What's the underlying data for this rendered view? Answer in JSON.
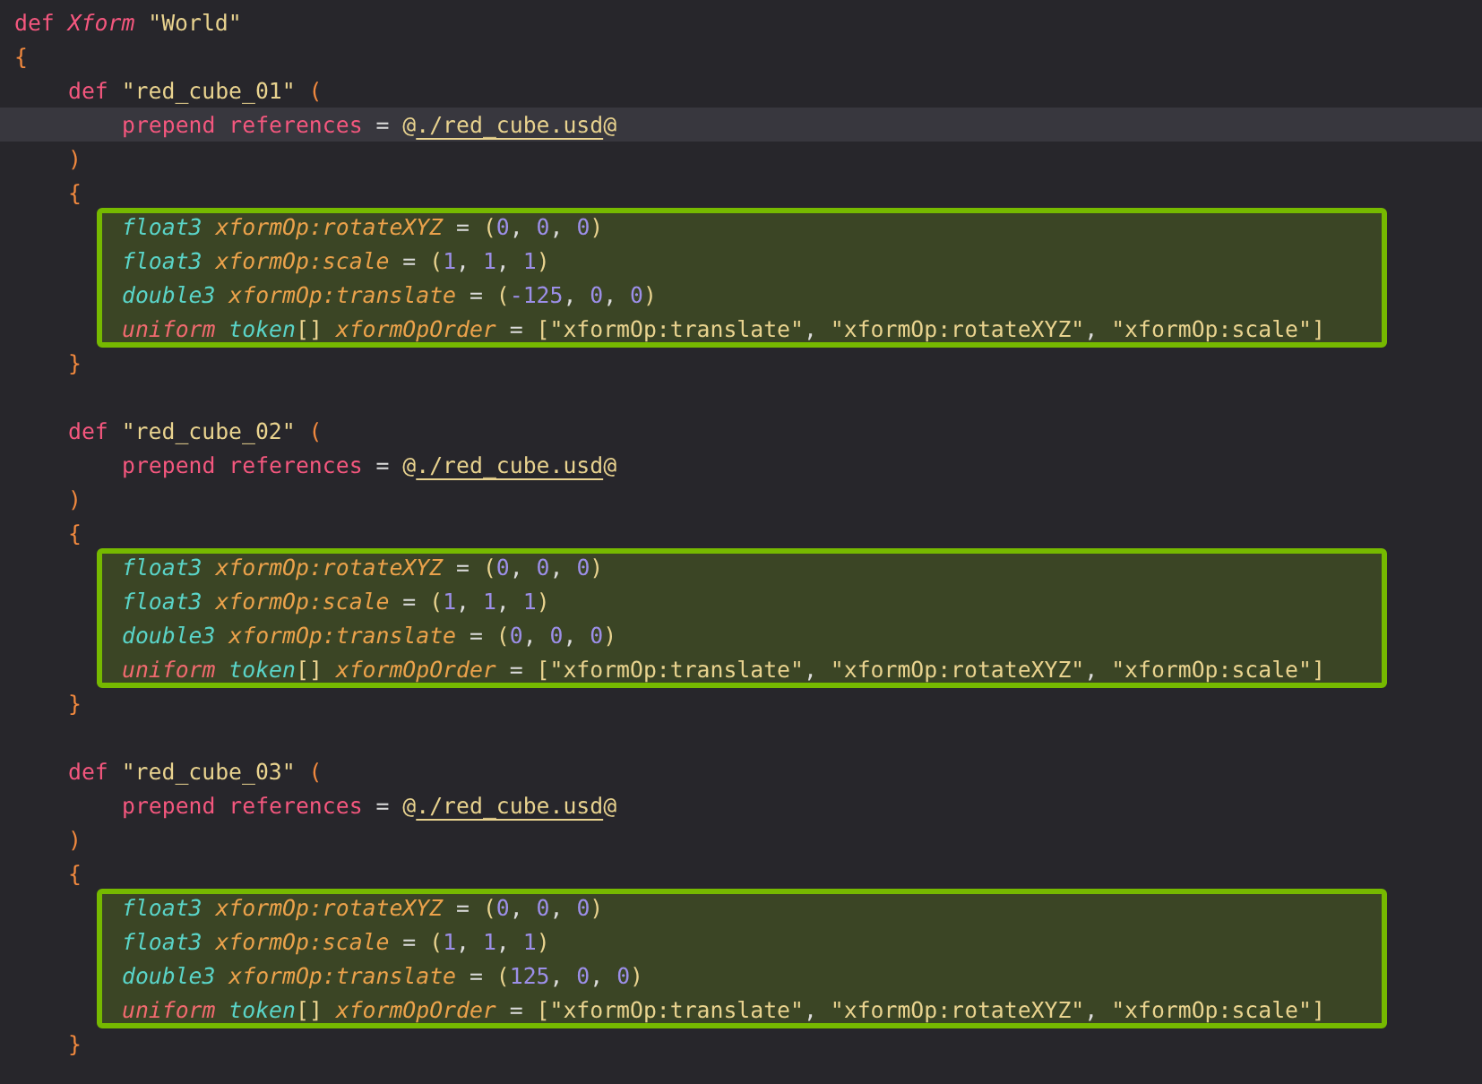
{
  "editor": {
    "lines": [
      {
        "kind": "line",
        "current": false,
        "tokens": [
          {
            "kind": "keyword",
            "text": "def"
          },
          {
            "kind": "typename",
            "text": " Xform"
          },
          {
            "kind": "string",
            "text": " \"World\""
          }
        ]
      },
      {
        "kind": "line",
        "current": false,
        "tokens": [
          {
            "kind": "brace",
            "text": "{"
          }
        ]
      },
      {
        "kind": "block",
        "children": [
          {
            "kind": "line",
            "current": false,
            "tokens": [
              {
                "kind": "keyword",
                "text": "def"
              },
              {
                "kind": "string",
                "text": " \"red_cube_01\""
              },
              {
                "kind": "brace",
                "text": " ("
              }
            ]
          },
          {
            "kind": "block",
            "children": [
              {
                "kind": "line",
                "current": true,
                "tokens": [
                  {
                    "kind": "keyword",
                    "text": "prepend"
                  },
                  {
                    "kind": "keyword",
                    "text": " references"
                  },
                  {
                    "kind": "operator",
                    "text": " = "
                  },
                  {
                    "kind": "string",
                    "text": "@"
                  },
                  {
                    "kind": "path",
                    "text": "./red_cube.usd"
                  },
                  {
                    "kind": "string",
                    "text": "@"
                  }
                ]
              }
            ]
          },
          {
            "kind": "line",
            "current": false,
            "tokens": [
              {
                "kind": "brace",
                "text": ")"
              }
            ]
          },
          {
            "kind": "line",
            "current": false,
            "tokens": [
              {
                "kind": "brace",
                "text": "{"
              }
            ]
          },
          {
            "kind": "highlight",
            "lines": [
              {
                "kind": "line",
                "current": false,
                "tokens": [
                  {
                    "kind": "type",
                    "text": "float3"
                  },
                  {
                    "kind": "attr",
                    "text": " xformOp:rotateXYZ"
                  },
                  {
                    "kind": "operator",
                    "text": " = "
                  },
                  {
                    "kind": "string",
                    "text": "("
                  },
                  {
                    "kind": "number",
                    "text": "0"
                  },
                  {
                    "kind": "operator",
                    "text": ", "
                  },
                  {
                    "kind": "number",
                    "text": "0"
                  },
                  {
                    "kind": "operator",
                    "text": ", "
                  },
                  {
                    "kind": "number",
                    "text": "0"
                  },
                  {
                    "kind": "string",
                    "text": ")"
                  }
                ]
              },
              {
                "kind": "line",
                "current": false,
                "tokens": [
                  {
                    "kind": "type",
                    "text": "float3"
                  },
                  {
                    "kind": "attr",
                    "text": " xformOp:scale"
                  },
                  {
                    "kind": "operator",
                    "text": " = "
                  },
                  {
                    "kind": "string",
                    "text": "("
                  },
                  {
                    "kind": "number",
                    "text": "1"
                  },
                  {
                    "kind": "operator",
                    "text": ", "
                  },
                  {
                    "kind": "number",
                    "text": "1"
                  },
                  {
                    "kind": "operator",
                    "text": ", "
                  },
                  {
                    "kind": "number",
                    "text": "1"
                  },
                  {
                    "kind": "string",
                    "text": ")"
                  }
                ]
              },
              {
                "kind": "line",
                "current": false,
                "tokens": [
                  {
                    "kind": "type",
                    "text": "double3"
                  },
                  {
                    "kind": "attr",
                    "text": " xformOp:translate"
                  },
                  {
                    "kind": "operator",
                    "text": " = "
                  },
                  {
                    "kind": "string",
                    "text": "("
                  },
                  {
                    "kind": "number",
                    "text": "-125"
                  },
                  {
                    "kind": "operator",
                    "text": ", "
                  },
                  {
                    "kind": "number",
                    "text": "0"
                  },
                  {
                    "kind": "operator",
                    "text": ", "
                  },
                  {
                    "kind": "number",
                    "text": "0"
                  },
                  {
                    "kind": "string",
                    "text": ")"
                  }
                ]
              },
              {
                "kind": "line",
                "current": false,
                "tokens": [
                  {
                    "kind": "uniform",
                    "text": "uniform"
                  },
                  {
                    "kind": "type",
                    "text": " token"
                  },
                  {
                    "kind": "string",
                    "text": "[]"
                  },
                  {
                    "kind": "attr",
                    "text": " xformOpOrder"
                  },
                  {
                    "kind": "operator",
                    "text": " = "
                  },
                  {
                    "kind": "string",
                    "text": "[\"xformOp:translate\""
                  },
                  {
                    "kind": "operator",
                    "text": ", "
                  },
                  {
                    "kind": "string",
                    "text": "\"xformOp:rotateXYZ\""
                  },
                  {
                    "kind": "operator",
                    "text": ", "
                  },
                  {
                    "kind": "string",
                    "text": "\"xformOp:scale\"]"
                  }
                ]
              }
            ]
          },
          {
            "kind": "line",
            "current": false,
            "tokens": [
              {
                "kind": "brace",
                "text": "}"
              }
            ]
          },
          {
            "kind": "blank"
          },
          {
            "kind": "line",
            "current": false,
            "tokens": [
              {
                "kind": "keyword",
                "text": "def"
              },
              {
                "kind": "string",
                "text": " \"red_cube_02\""
              },
              {
                "kind": "brace",
                "text": " ("
              }
            ]
          },
          {
            "kind": "block",
            "children": [
              {
                "kind": "line",
                "current": false,
                "tokens": [
                  {
                    "kind": "keyword",
                    "text": "prepend"
                  },
                  {
                    "kind": "keyword",
                    "text": " references"
                  },
                  {
                    "kind": "operator",
                    "text": " = "
                  },
                  {
                    "kind": "string",
                    "text": "@"
                  },
                  {
                    "kind": "path",
                    "text": "./red_cube.usd"
                  },
                  {
                    "kind": "string",
                    "text": "@"
                  }
                ]
              }
            ]
          },
          {
            "kind": "line",
            "current": false,
            "tokens": [
              {
                "kind": "brace",
                "text": ")"
              }
            ]
          },
          {
            "kind": "line",
            "current": false,
            "tokens": [
              {
                "kind": "brace",
                "text": "{"
              }
            ]
          },
          {
            "kind": "highlight",
            "lines": [
              {
                "kind": "line",
                "current": false,
                "tokens": [
                  {
                    "kind": "type",
                    "text": "float3"
                  },
                  {
                    "kind": "attr",
                    "text": " xformOp:rotateXYZ"
                  },
                  {
                    "kind": "operator",
                    "text": " = "
                  },
                  {
                    "kind": "string",
                    "text": "("
                  },
                  {
                    "kind": "number",
                    "text": "0"
                  },
                  {
                    "kind": "operator",
                    "text": ", "
                  },
                  {
                    "kind": "number",
                    "text": "0"
                  },
                  {
                    "kind": "operator",
                    "text": ", "
                  },
                  {
                    "kind": "number",
                    "text": "0"
                  },
                  {
                    "kind": "string",
                    "text": ")"
                  }
                ]
              },
              {
                "kind": "line",
                "current": false,
                "tokens": [
                  {
                    "kind": "type",
                    "text": "float3"
                  },
                  {
                    "kind": "attr",
                    "text": " xformOp:scale"
                  },
                  {
                    "kind": "operator",
                    "text": " = "
                  },
                  {
                    "kind": "string",
                    "text": "("
                  },
                  {
                    "kind": "number",
                    "text": "1"
                  },
                  {
                    "kind": "operator",
                    "text": ", "
                  },
                  {
                    "kind": "number",
                    "text": "1"
                  },
                  {
                    "kind": "operator",
                    "text": ", "
                  },
                  {
                    "kind": "number",
                    "text": "1"
                  },
                  {
                    "kind": "string",
                    "text": ")"
                  }
                ]
              },
              {
                "kind": "line",
                "current": false,
                "tokens": [
                  {
                    "kind": "type",
                    "text": "double3"
                  },
                  {
                    "kind": "attr",
                    "text": " xformOp:translate"
                  },
                  {
                    "kind": "operator",
                    "text": " = "
                  },
                  {
                    "kind": "string",
                    "text": "("
                  },
                  {
                    "kind": "number",
                    "text": "0"
                  },
                  {
                    "kind": "operator",
                    "text": ", "
                  },
                  {
                    "kind": "number",
                    "text": "0"
                  },
                  {
                    "kind": "operator",
                    "text": ", "
                  },
                  {
                    "kind": "number",
                    "text": "0"
                  },
                  {
                    "kind": "string",
                    "text": ")"
                  }
                ]
              },
              {
                "kind": "line",
                "current": false,
                "tokens": [
                  {
                    "kind": "uniform",
                    "text": "uniform"
                  },
                  {
                    "kind": "type",
                    "text": " token"
                  },
                  {
                    "kind": "string",
                    "text": "[]"
                  },
                  {
                    "kind": "attr",
                    "text": " xformOpOrder"
                  },
                  {
                    "kind": "operator",
                    "text": " = "
                  },
                  {
                    "kind": "string",
                    "text": "[\"xformOp:translate\""
                  },
                  {
                    "kind": "operator",
                    "text": ", "
                  },
                  {
                    "kind": "string",
                    "text": "\"xformOp:rotateXYZ\""
                  },
                  {
                    "kind": "operator",
                    "text": ", "
                  },
                  {
                    "kind": "string",
                    "text": "\"xformOp:scale\"]"
                  }
                ]
              }
            ]
          },
          {
            "kind": "line",
            "current": false,
            "tokens": [
              {
                "kind": "brace",
                "text": "}"
              }
            ]
          },
          {
            "kind": "blank"
          },
          {
            "kind": "line",
            "current": false,
            "tokens": [
              {
                "kind": "keyword",
                "text": "def"
              },
              {
                "kind": "string",
                "text": " \"red_cube_03\""
              },
              {
                "kind": "brace",
                "text": " ("
              }
            ]
          },
          {
            "kind": "block",
            "children": [
              {
                "kind": "line",
                "current": false,
                "tokens": [
                  {
                    "kind": "keyword",
                    "text": "prepend"
                  },
                  {
                    "kind": "keyword",
                    "text": " references"
                  },
                  {
                    "kind": "operator",
                    "text": " = "
                  },
                  {
                    "kind": "string",
                    "text": "@"
                  },
                  {
                    "kind": "path",
                    "text": "./red_cube.usd"
                  },
                  {
                    "kind": "string",
                    "text": "@"
                  }
                ]
              }
            ]
          },
          {
            "kind": "line",
            "current": false,
            "tokens": [
              {
                "kind": "brace",
                "text": ")"
              }
            ]
          },
          {
            "kind": "line",
            "current": false,
            "tokens": [
              {
                "kind": "brace",
                "text": "{"
              }
            ]
          },
          {
            "kind": "highlight",
            "lines": [
              {
                "kind": "line",
                "current": false,
                "tokens": [
                  {
                    "kind": "type",
                    "text": "float3"
                  },
                  {
                    "kind": "attr",
                    "text": " xformOp:rotateXYZ"
                  },
                  {
                    "kind": "operator",
                    "text": " = "
                  },
                  {
                    "kind": "string",
                    "text": "("
                  },
                  {
                    "kind": "number",
                    "text": "0"
                  },
                  {
                    "kind": "operator",
                    "text": ", "
                  },
                  {
                    "kind": "number",
                    "text": "0"
                  },
                  {
                    "kind": "operator",
                    "text": ", "
                  },
                  {
                    "kind": "number",
                    "text": "0"
                  },
                  {
                    "kind": "string",
                    "text": ")"
                  }
                ]
              },
              {
                "kind": "line",
                "current": false,
                "tokens": [
                  {
                    "kind": "type",
                    "text": "float3"
                  },
                  {
                    "kind": "attr",
                    "text": " xformOp:scale"
                  },
                  {
                    "kind": "operator",
                    "text": " = "
                  },
                  {
                    "kind": "string",
                    "text": "("
                  },
                  {
                    "kind": "number",
                    "text": "1"
                  },
                  {
                    "kind": "operator",
                    "text": ", "
                  },
                  {
                    "kind": "number",
                    "text": "1"
                  },
                  {
                    "kind": "operator",
                    "text": ", "
                  },
                  {
                    "kind": "number",
                    "text": "1"
                  },
                  {
                    "kind": "string",
                    "text": ")"
                  }
                ]
              },
              {
                "kind": "line",
                "current": false,
                "tokens": [
                  {
                    "kind": "type",
                    "text": "double3"
                  },
                  {
                    "kind": "attr",
                    "text": " xformOp:translate"
                  },
                  {
                    "kind": "operator",
                    "text": " = "
                  },
                  {
                    "kind": "string",
                    "text": "("
                  },
                  {
                    "kind": "number",
                    "text": "125"
                  },
                  {
                    "kind": "operator",
                    "text": ", "
                  },
                  {
                    "kind": "number",
                    "text": "0"
                  },
                  {
                    "kind": "operator",
                    "text": ", "
                  },
                  {
                    "kind": "number",
                    "text": "0"
                  },
                  {
                    "kind": "string",
                    "text": ")"
                  }
                ]
              },
              {
                "kind": "line",
                "current": false,
                "tokens": [
                  {
                    "kind": "uniform",
                    "text": "uniform"
                  },
                  {
                    "kind": "type",
                    "text": " token"
                  },
                  {
                    "kind": "string",
                    "text": "[]"
                  },
                  {
                    "kind": "attr",
                    "text": " xformOpOrder"
                  },
                  {
                    "kind": "operator",
                    "text": " = "
                  },
                  {
                    "kind": "string",
                    "text": "[\"xformOp:translate\""
                  },
                  {
                    "kind": "operator",
                    "text": ", "
                  },
                  {
                    "kind": "string",
                    "text": "\"xformOp:rotateXYZ\""
                  },
                  {
                    "kind": "operator",
                    "text": ", "
                  },
                  {
                    "kind": "string",
                    "text": "\"xformOp:scale\"]"
                  }
                ]
              }
            ]
          },
          {
            "kind": "line",
            "current": false,
            "tokens": [
              {
                "kind": "brace",
                "text": "}"
              }
            ]
          }
        ]
      }
    ]
  }
}
